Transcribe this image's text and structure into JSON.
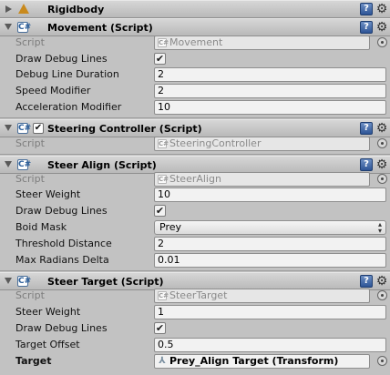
{
  "rigidbody": {
    "title": "Rigidbody"
  },
  "movement": {
    "title": "Movement (Script)",
    "script_label": "Script",
    "script_value": "Movement",
    "draw_debug_lines_label": "Draw Debug Lines",
    "debug_line_duration_label": "Debug Line Duration",
    "debug_line_duration_value": "2",
    "speed_modifier_label": "Speed Modifier",
    "speed_modifier_value": "2",
    "acceleration_modifier_label": "Acceleration Modifier",
    "acceleration_modifier_value": "10"
  },
  "steering_controller": {
    "title": "Steering Controller (Script)",
    "script_label": "Script",
    "script_value": "SteeringController"
  },
  "steer_align": {
    "title": "Steer Align (Script)",
    "script_label": "Script",
    "script_value": "SteerAlign",
    "steer_weight_label": "Steer Weight",
    "steer_weight_value": "10",
    "draw_debug_lines_label": "Draw Debug Lines",
    "boid_mask_label": "Boid Mask",
    "boid_mask_value": "Prey",
    "threshold_distance_label": "Threshold Distance",
    "threshold_distance_value": "2",
    "max_radians_delta_label": "Max Radians Delta",
    "max_radians_delta_value": "0.01"
  },
  "steer_target": {
    "title": "Steer Target (Script)",
    "script_label": "Script",
    "script_value": "SteerTarget",
    "steer_weight_label": "Steer Weight",
    "steer_weight_value": "1",
    "draw_debug_lines_label": "Draw Debug Lines",
    "target_offset_label": "Target Offset",
    "target_offset_value": "0.5",
    "target_label": "Target",
    "target_value": "Prey_Align Target (Transform)"
  },
  "icons": {
    "check_glyph": "✔",
    "help_glyph": "?",
    "gear_glyph": "⚙",
    "script_glyph": "C#",
    "dropdown_glyph": "▲▼"
  }
}
